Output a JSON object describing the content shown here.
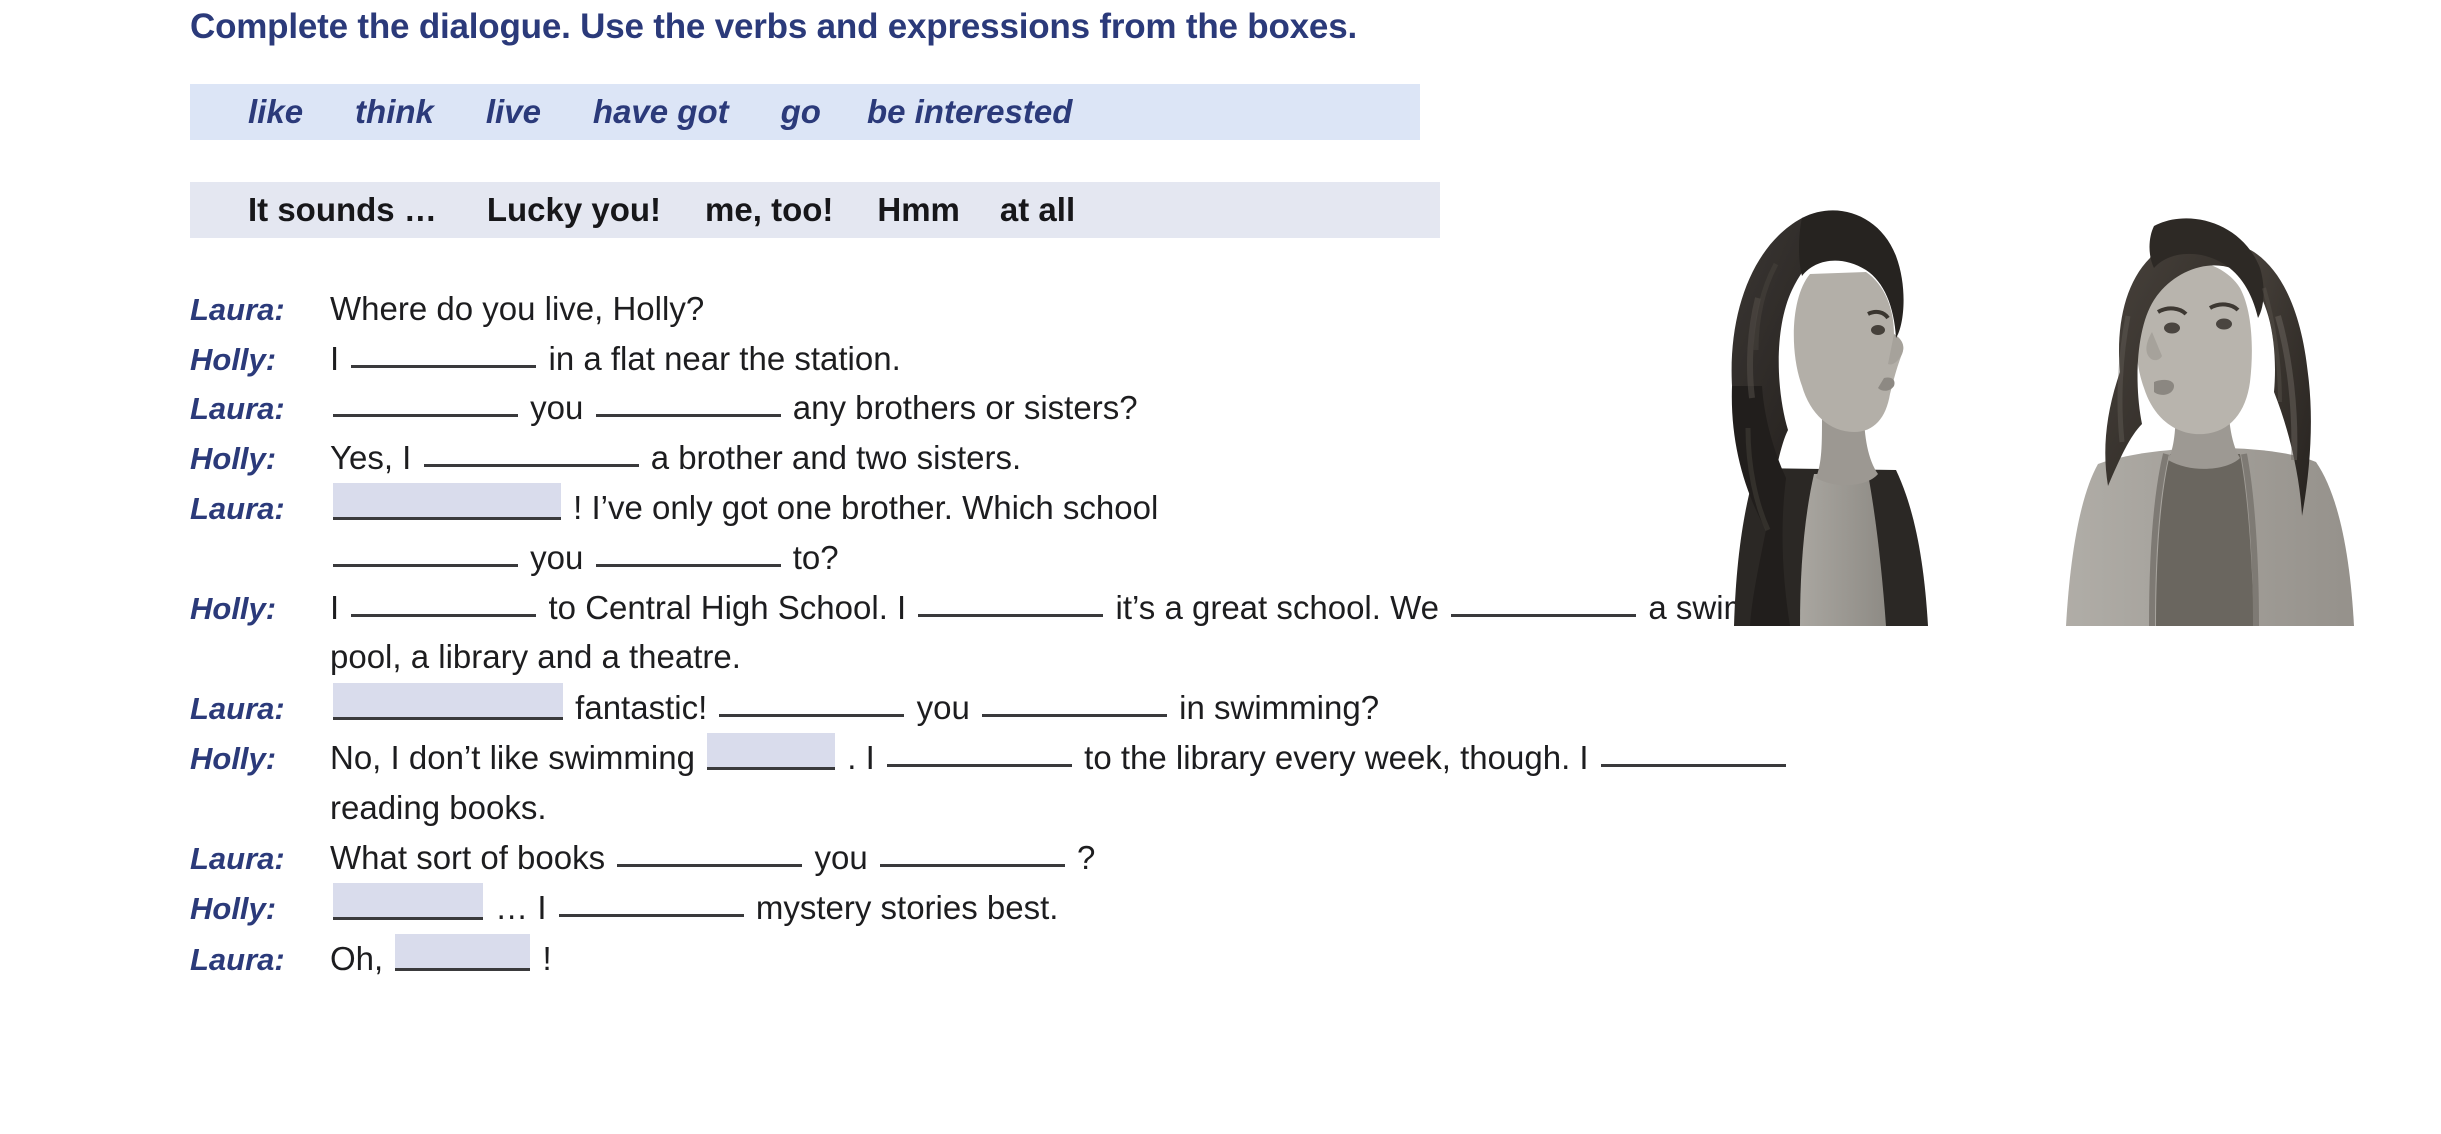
{
  "heading": "Complete the dialogue. Use the verbs and expressions from the boxes.",
  "verb_box": {
    "name": "verbs-box",
    "words": [
      "like",
      "think",
      "live",
      "have got",
      "go",
      "be interested"
    ]
  },
  "expression_box": {
    "name": "expressions-box",
    "words": [
      "It sounds …",
      "Lucky you!",
      "me, too!",
      "Hmm",
      "at all"
    ]
  },
  "dialogue": [
    {
      "speaker": "Laura:",
      "parts": [
        {
          "t": "text",
          "v": "Where do you live, Holly?"
        }
      ]
    },
    {
      "speaker": "Holly:",
      "parts": [
        {
          "t": "text",
          "v": "I"
        },
        {
          "t": "blank",
          "w": "w-lg"
        },
        {
          "t": "text",
          "v": "in a flat near the station."
        }
      ]
    },
    {
      "speaker": "Laura:",
      "parts": [
        {
          "t": "blank",
          "w": "w-lg"
        },
        {
          "t": "text",
          "v": "you"
        },
        {
          "t": "blank",
          "w": "w-lg"
        },
        {
          "t": "text",
          "v": "any brothers or sisters?"
        }
      ]
    },
    {
      "speaker": "Holly:",
      "parts": [
        {
          "t": "text",
          "v": "Yes, I"
        },
        {
          "t": "blank",
          "w": "w-xl"
        },
        {
          "t": "text",
          "v": "a brother and two sisters."
        }
      ]
    },
    {
      "speaker": "Laura:",
      "parts": [
        {
          "t": "blank",
          "w": "shaded w-hl1"
        },
        {
          "t": "text",
          "v": "! I’ve only got one brother. Which school"
        }
      ]
    },
    {
      "speaker": "",
      "parts": [
        {
          "t": "blank",
          "w": "w-lg"
        },
        {
          "t": "text",
          "v": "you"
        },
        {
          "t": "blank",
          "w": "w-lg"
        },
        {
          "t": "text",
          "v": "to?"
        }
      ]
    },
    {
      "speaker": "Holly:",
      "parts": [
        {
          "t": "text",
          "v": "I"
        },
        {
          "t": "blank",
          "w": "w-lg"
        },
        {
          "t": "text",
          "v": "to Central High School. I"
        },
        {
          "t": "blank",
          "w": "w-lg"
        },
        {
          "t": "text",
          "v": "it’s a great school. We"
        },
        {
          "t": "blank",
          "w": "w-lg"
        },
        {
          "t": "text",
          "v": "a swimming"
        }
      ]
    },
    {
      "speaker": "",
      "parts": [
        {
          "t": "text",
          "v": "pool, a library and a theatre."
        }
      ]
    },
    {
      "speaker": "Laura:",
      "parts": [
        {
          "t": "blank",
          "w": "shaded w-hl2"
        },
        {
          "t": "text",
          "v": "fantastic!"
        },
        {
          "t": "blank",
          "w": "w-lg"
        },
        {
          "t": "text",
          "v": "you"
        },
        {
          "t": "blank",
          "w": "w-lg"
        },
        {
          "t": "text",
          "v": "in swimming?"
        }
      ]
    },
    {
      "speaker": "Holly:",
      "parts": [
        {
          "t": "text",
          "v": "No, I don’t like swimming"
        },
        {
          "t": "blank",
          "w": "shaded w-hl3"
        },
        {
          "t": "text",
          "v": ". I"
        },
        {
          "t": "blank",
          "w": "w-lg"
        },
        {
          "t": "text",
          "v": "to the library every week, though. I"
        },
        {
          "t": "blank",
          "w": "w-lg"
        }
      ]
    },
    {
      "speaker": "",
      "parts": [
        {
          "t": "text",
          "v": "reading books."
        }
      ]
    },
    {
      "speaker": "Laura:",
      "parts": [
        {
          "t": "text",
          "v": "What sort of books"
        },
        {
          "t": "blank",
          "w": "w-lg"
        },
        {
          "t": "text",
          "v": "you"
        },
        {
          "t": "blank",
          "w": "w-lg"
        },
        {
          "t": "text",
          "v": "?"
        }
      ]
    },
    {
      "speaker": "Holly:",
      "parts": [
        {
          "t": "blank",
          "w": "shaded w-hl4"
        },
        {
          "t": "text",
          "v": "… I"
        },
        {
          "t": "blank",
          "w": "w-lg"
        },
        {
          "t": "text",
          "v": "mystery stories best."
        }
      ]
    },
    {
      "speaker": "Laura:",
      "parts": [
        {
          "t": "text",
          "v": "Oh,"
        },
        {
          "t": "blank",
          "w": "shaded w-hl5"
        },
        {
          "t": "text",
          "v": "!"
        }
      ]
    }
  ],
  "photo": {
    "alt_left": "photo of girl with dark curly hair facing right",
    "alt_right": "photo of girl with long straight hair facing left"
  },
  "colors": {
    "heading_navy": "#2b3a7a",
    "verb_box_bg": "#dce5f6",
    "expression_box_bg": "#e4e7f1",
    "blank_shade": "#d9dcec",
    "body_text": "#1d1d1f"
  }
}
